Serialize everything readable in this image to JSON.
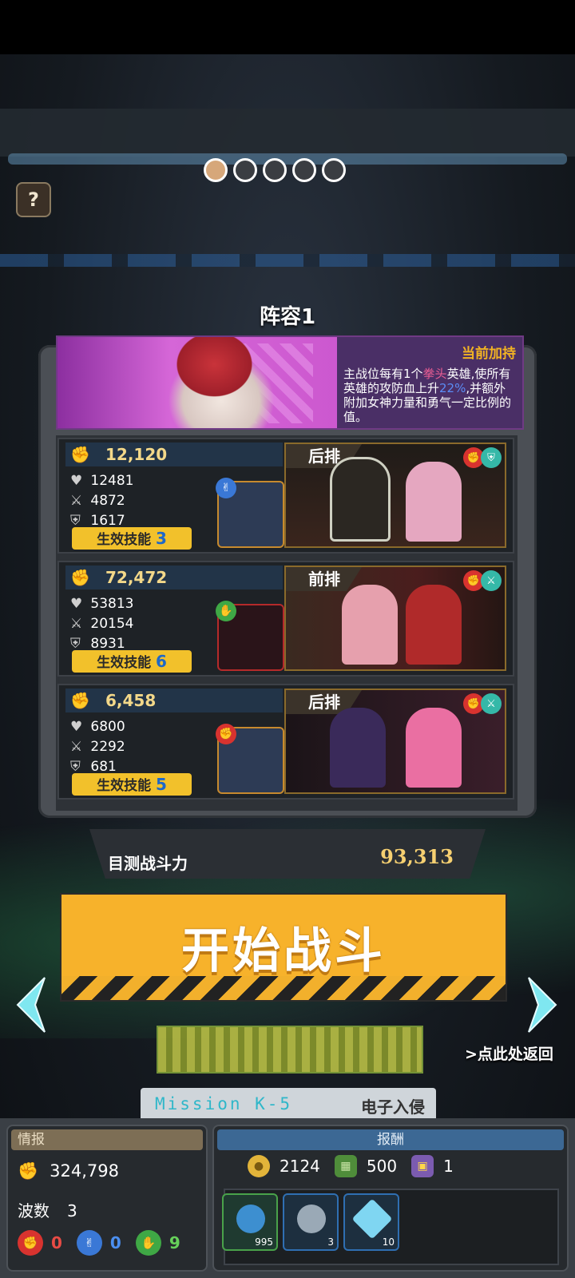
{
  "page_dots": {
    "count": 5,
    "active_index": 0
  },
  "help_label": "?",
  "lineup_title": "阵容1",
  "bonus": {
    "header": "当前加持",
    "desc_parts": [
      "主战位每有1个",
      "拳头",
      "英雄,使所有英雄的攻防血上升",
      "22%",
      ",并额外附加女神力量和勇气一定比例的值。"
    ]
  },
  "teams": [
    {
      "power": "12,120",
      "hp": "12481",
      "atk": "4872",
      "def": "1617",
      "skill_label": "生效技能",
      "skill_count": "3",
      "position": "后排",
      "element_icon": "scissors-icon"
    },
    {
      "power": "72,472",
      "hp": "53813",
      "atk": "20154",
      "def": "8931",
      "skill_label": "生效技能",
      "skill_count": "6",
      "position": "前排",
      "element_icon": "palm-icon"
    },
    {
      "power": "6,458",
      "hp": "6800",
      "atk": "2292",
      "def": "681",
      "skill_label": "生效技能",
      "skill_count": "5",
      "position": "后排",
      "element_icon": "fist-icon"
    }
  ],
  "combat_power": {
    "label": "目测战斗力",
    "value": "93,313"
  },
  "start_button": "开始战斗",
  "back_link": ">点此处返回",
  "mission": {
    "code": "Mission K-5",
    "name": "电子入侵"
  },
  "intel": {
    "header": "情报",
    "power": "324,798",
    "waves_label": "波数",
    "waves": "3",
    "elements": [
      {
        "type": "fist",
        "count": "0",
        "color": "#e84b45"
      },
      {
        "type": "scissors",
        "count": "0",
        "color": "#4b8ff0"
      },
      {
        "type": "palm",
        "count": "9",
        "color": "#66d05a"
      }
    ]
  },
  "rewards": {
    "header": "报酬",
    "currencies": [
      {
        "icon": "coin-icon",
        "amount": "2124"
      },
      {
        "icon": "cash-icon",
        "amount": "500"
      },
      {
        "icon": "ticket-icon",
        "amount": "1"
      }
    ],
    "items": [
      {
        "icon": "gear-core-icon",
        "qty": "995"
      },
      {
        "icon": "egg-icon",
        "qty": "3"
      },
      {
        "icon": "crystal-icon",
        "qty": "10"
      }
    ]
  }
}
